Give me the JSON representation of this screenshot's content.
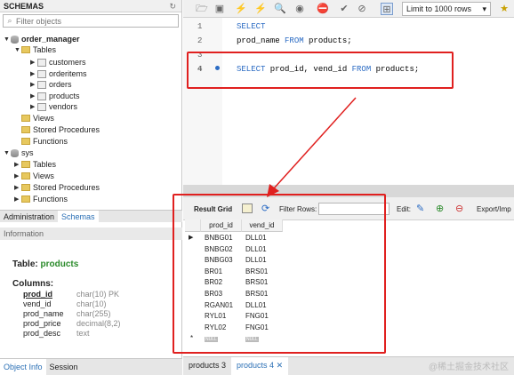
{
  "navigator": {
    "header": "SCHEMAS",
    "filter_placeholder": "Filter objects",
    "schemas": [
      {
        "name": "order_manager",
        "children": [
          {
            "name": "Tables",
            "items": [
              "customers",
              "orderitems",
              "orders",
              "products",
              "vendors"
            ]
          },
          {
            "name": "Views"
          },
          {
            "name": "Stored Procedures"
          },
          {
            "name": "Functions"
          }
        ]
      },
      {
        "name": "sys",
        "children": [
          {
            "name": "Tables"
          },
          {
            "name": "Views"
          },
          {
            "name": "Stored Procedures"
          },
          {
            "name": "Functions"
          }
        ]
      }
    ],
    "tabs": [
      "Administration",
      "Schemas"
    ],
    "info_header": "Information",
    "info": {
      "table_label": "Table:",
      "table_name": "products",
      "columns_label": "Columns:",
      "columns": [
        {
          "name": "prod_id",
          "type": "char(10) PK"
        },
        {
          "name": "vend_id",
          "type": "char(10)"
        },
        {
          "name": "prod_name",
          "type": "char(255)"
        },
        {
          "name": "prod_price",
          "type": "decimal(8,2)"
        },
        {
          "name": "prod_desc",
          "type": "text"
        }
      ]
    },
    "bottom_tabs": [
      "Object Info",
      "Session"
    ]
  },
  "editor": {
    "limit_select": "Limit to 1000 rows",
    "lines": [
      {
        "num": "1",
        "kw1": "SELECT",
        "rest": ""
      },
      {
        "num": "2",
        "text": "prod_name ",
        "kw": "FROM",
        "text2": " products;"
      },
      {
        "num": "3"
      },
      {
        "num": "4",
        "kw1": "SELECT",
        "text": " prod_id, vend_id ",
        "kw": "FROM",
        "text2": " products;"
      }
    ]
  },
  "results": {
    "result_grid_label": "Result Grid",
    "filter_label": "Filter Rows:",
    "edit_label": "Edit:",
    "export_label": "Export/Imp",
    "columns": [
      "prod_id",
      "vend_id"
    ],
    "rows": [
      [
        "BNBG01",
        "DLL01"
      ],
      [
        "BNBG02",
        "DLL01"
      ],
      [
        "BNBG03",
        "DLL01"
      ],
      [
        "BR01",
        "BRS01"
      ],
      [
        "BR02",
        "BRS01"
      ],
      [
        "BR03",
        "BRS01"
      ],
      [
        "RGAN01",
        "DLL01"
      ],
      [
        "RYL01",
        "FNG01"
      ],
      [
        "RYL02",
        "FNG01"
      ]
    ],
    "null_label": "NULL"
  },
  "bottom_tabs": [
    "products 3",
    "products 4"
  ],
  "watermark": "@稀土掘金技术社区"
}
